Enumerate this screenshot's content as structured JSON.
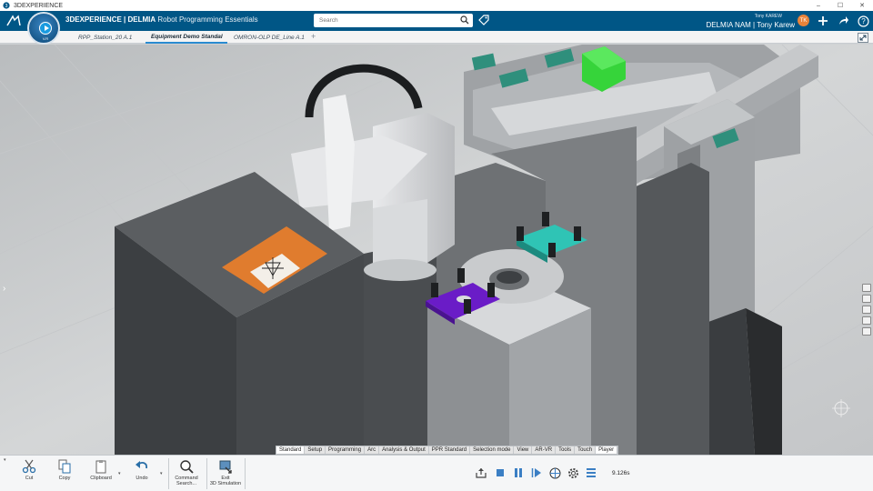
{
  "window": {
    "title": "3DEXPERIENCE",
    "controls": [
      "–",
      "☐",
      "✕"
    ]
  },
  "topbar": {
    "brand_prefix": "3D",
    "brand_main": "EXPERIENCE | DELMIA",
    "app_name": "Robot Programming Essentials",
    "search_placeholder": "Search",
    "user_small": "Tony KAREW",
    "user_name": "DELMIA NAM | Tony Karew",
    "avatar_initials": "TK",
    "icons": [
      "tag-icon",
      "add-icon",
      "share-icon",
      "help-icon"
    ]
  },
  "compass": {
    "version": "V.R"
  },
  "tabs": [
    {
      "label": "RPP_Station_20 A.1",
      "active": false
    },
    {
      "label": "Equipment Demo Standal",
      "active": true
    },
    {
      "label": "OMRON-OLP DE_Line A.1",
      "active": false
    }
  ],
  "tab_add": "+",
  "sections": [
    {
      "label": "Standard",
      "active": true
    },
    {
      "label": "Setup",
      "active": false
    },
    {
      "label": "Programming",
      "active": false
    },
    {
      "label": "Arc",
      "active": false
    },
    {
      "label": "Analysis & Output",
      "active": false
    },
    {
      "label": "PPR Standard",
      "active": false
    },
    {
      "label": "Selection mode",
      "active": false
    },
    {
      "label": "View",
      "active": false
    },
    {
      "label": "AR-VR",
      "active": false
    },
    {
      "label": "Tools",
      "active": false
    },
    {
      "label": "Touch",
      "active": false
    },
    {
      "label": "Player",
      "active": true
    }
  ],
  "actions": {
    "cut": "Cut",
    "copy": "Copy",
    "clipboard": "Clipboard",
    "undo": "Undo",
    "command_search_1": "Command",
    "command_search_2": "Search...",
    "exit_sim_1": "Exit",
    "exit_sim_2": "3D Simulation"
  },
  "player": {
    "time": "9.126s",
    "icons": [
      "export-icon",
      "stop-icon",
      "pause-icon",
      "play-icon",
      "simulation-icon",
      "settings-icon",
      "list-icon"
    ]
  },
  "colors": {
    "topbar": "#005686",
    "accent": "#2a8bd0",
    "fixture_teal": "#2fc4b5",
    "fixture_purple": "#6a1cc7",
    "part_green": "#36d43a",
    "work_area_orange": "#e07c2e"
  }
}
